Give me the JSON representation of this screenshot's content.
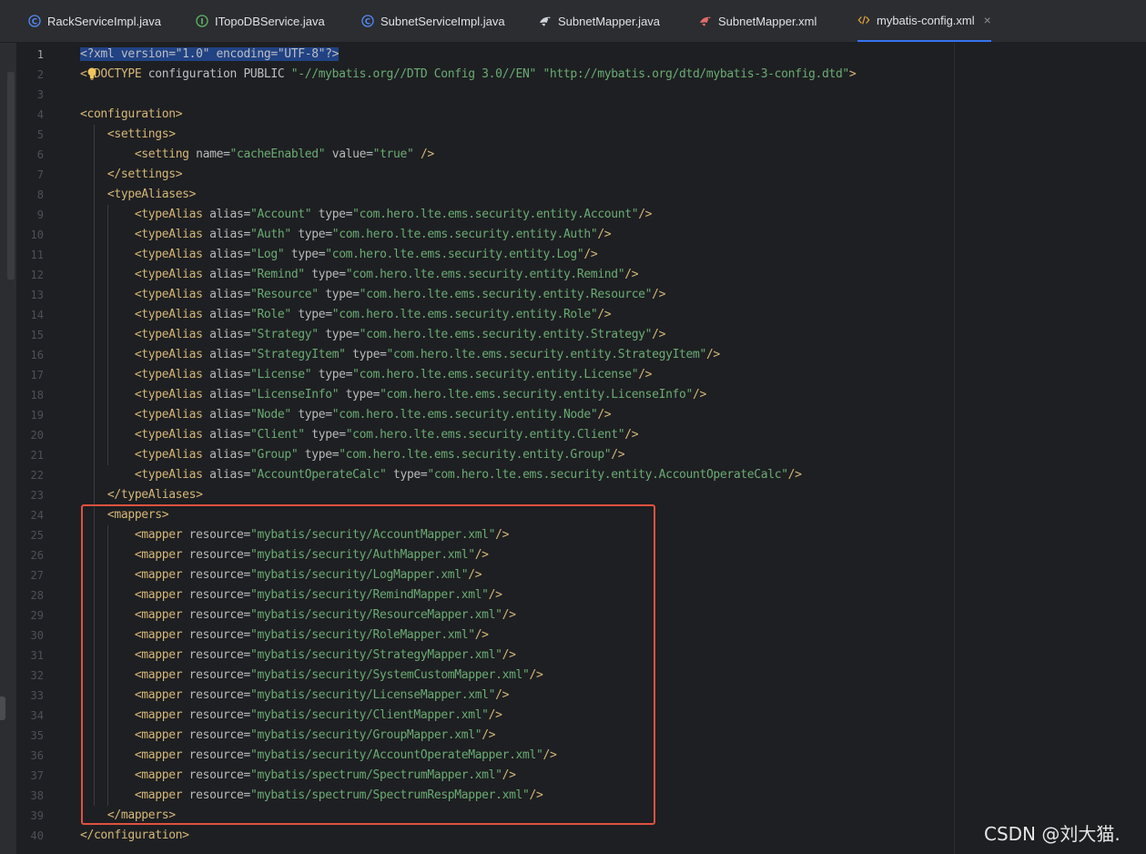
{
  "tabs": [
    {
      "label": "RackServiceImpl.java",
      "icon": "class-icon",
      "icon_color": "#548af7"
    },
    {
      "label": "ITopoDBService.java",
      "icon": "interface-icon",
      "icon_color": "#5fb865"
    },
    {
      "label": "SubnetServiceImpl.java",
      "icon": "class-icon",
      "icon_color": "#548af7"
    },
    {
      "label": "SubnetMapper.java",
      "icon": "mybatis-bird-icon",
      "icon_color": "#cfd3da"
    },
    {
      "label": "SubnetMapper.xml",
      "icon": "mybatis-bird-icon",
      "icon_color": "#e06c6c"
    },
    {
      "label": "mybatis-config.xml",
      "icon": "xml-icon",
      "icon_color": "#e8a33e",
      "active": true,
      "close": "×"
    }
  ],
  "editor": {
    "language": "xml",
    "highlight_box_color": "#e0523f",
    "lines": [
      {
        "n": "1",
        "text": "<?xml version=\"1.0\" encoding=\"UTF-8\"?>"
      },
      {
        "n": "2",
        "text": "<!DOCTYPE configuration PUBLIC \"-//mybatis.org//DTD Config 3.0//EN\" \"http://mybatis.org/dtd/mybatis-3-config.dtd\">"
      },
      {
        "n": "3",
        "text": ""
      },
      {
        "n": "4",
        "text": "<configuration>"
      },
      {
        "n": "5",
        "text": "    <settings>"
      },
      {
        "n": "6",
        "text": "        <setting name=\"cacheEnabled\" value=\"true\" />"
      },
      {
        "n": "7",
        "text": "    </settings>"
      },
      {
        "n": "8",
        "text": "    <typeAliases>"
      },
      {
        "n": "9",
        "text": "        <typeAlias alias=\"Account\" type=\"com.hero.lte.ems.security.entity.Account\"/>"
      },
      {
        "n": "10",
        "text": "        <typeAlias alias=\"Auth\" type=\"com.hero.lte.ems.security.entity.Auth\"/>"
      },
      {
        "n": "11",
        "text": "        <typeAlias alias=\"Log\" type=\"com.hero.lte.ems.security.entity.Log\"/>"
      },
      {
        "n": "12",
        "text": "        <typeAlias alias=\"Remind\" type=\"com.hero.lte.ems.security.entity.Remind\"/>"
      },
      {
        "n": "13",
        "text": "        <typeAlias alias=\"Resource\" type=\"com.hero.lte.ems.security.entity.Resource\"/>"
      },
      {
        "n": "14",
        "text": "        <typeAlias alias=\"Role\" type=\"com.hero.lte.ems.security.entity.Role\"/>"
      },
      {
        "n": "15",
        "text": "        <typeAlias alias=\"Strategy\" type=\"com.hero.lte.ems.security.entity.Strategy\"/>"
      },
      {
        "n": "16",
        "text": "        <typeAlias alias=\"StrategyItem\" type=\"com.hero.lte.ems.security.entity.StrategyItem\"/>"
      },
      {
        "n": "17",
        "text": "        <typeAlias alias=\"License\" type=\"com.hero.lte.ems.security.entity.License\"/>"
      },
      {
        "n": "18",
        "text": "        <typeAlias alias=\"LicenseInfo\" type=\"com.hero.lte.ems.security.entity.LicenseInfo\"/>"
      },
      {
        "n": "19",
        "text": "        <typeAlias alias=\"Node\" type=\"com.hero.lte.ems.security.entity.Node\"/>"
      },
      {
        "n": "20",
        "text": "        <typeAlias alias=\"Client\" type=\"com.hero.lte.ems.security.entity.Client\"/>"
      },
      {
        "n": "21",
        "text": "        <typeAlias alias=\"Group\" type=\"com.hero.lte.ems.security.entity.Group\"/>"
      },
      {
        "n": "22",
        "text": "        <typeAlias alias=\"AccountOperateCalc\" type=\"com.hero.lte.ems.security.entity.AccountOperateCalc\"/>"
      },
      {
        "n": "23",
        "text": "    </typeAliases>"
      },
      {
        "n": "24",
        "text": "    <mappers>"
      },
      {
        "n": "25",
        "text": "        <mapper resource=\"mybatis/security/AccountMapper.xml\"/>"
      },
      {
        "n": "26",
        "text": "        <mapper resource=\"mybatis/security/AuthMapper.xml\"/>"
      },
      {
        "n": "27",
        "text": "        <mapper resource=\"mybatis/security/LogMapper.xml\"/>"
      },
      {
        "n": "28",
        "text": "        <mapper resource=\"mybatis/security/RemindMapper.xml\"/>"
      },
      {
        "n": "29",
        "text": "        <mapper resource=\"mybatis/security/ResourceMapper.xml\"/>"
      },
      {
        "n": "30",
        "text": "        <mapper resource=\"mybatis/security/RoleMapper.xml\"/>"
      },
      {
        "n": "31",
        "text": "        <mapper resource=\"mybatis/security/StrategyMapper.xml\"/>"
      },
      {
        "n": "32",
        "text": "        <mapper resource=\"mybatis/security/SystemCustomMapper.xml\"/>"
      },
      {
        "n": "33",
        "text": "        <mapper resource=\"mybatis/security/LicenseMapper.xml\"/>"
      },
      {
        "n": "34",
        "text": "        <mapper resource=\"mybatis/security/ClientMapper.xml\"/>"
      },
      {
        "n": "35",
        "text": "        <mapper resource=\"mybatis/security/GroupMapper.xml\"/>"
      },
      {
        "n": "36",
        "text": "        <mapper resource=\"mybatis/security/AccountOperateMapper.xml\"/>"
      },
      {
        "n": "37",
        "text": "        <mapper resource=\"mybatis/spectrum/SpectrumMapper.xml\"/>"
      },
      {
        "n": "38",
        "text": "        <mapper resource=\"mybatis/spectrum/SpectrumRespMapper.xml\"/>"
      },
      {
        "n": "39",
        "text": "    </mappers>"
      },
      {
        "n": "40",
        "text": "</configuration>"
      }
    ]
  },
  "watermark": "CSDN @刘大猫."
}
